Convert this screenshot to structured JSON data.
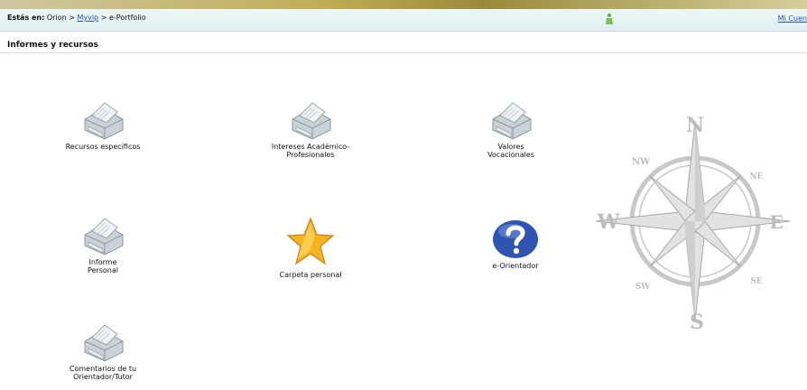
{
  "breadcrumb": {
    "prefix": "Estás en:",
    "root": "Orion",
    "sep1": ">",
    "link": "Myvip",
    "sep2": ">",
    "current": "e-Portfolio"
  },
  "account_link": "Mi Cuen",
  "section": {
    "title": "Informes y recursos"
  },
  "items": [
    {
      "label": "Recursos específicos",
      "icon": "printer-icon"
    },
    {
      "label": "Intereses Académico-Profesionales",
      "icon": "printer-icon"
    },
    {
      "label": "Valores Vocacionales",
      "icon": "printer-icon"
    },
    {
      "label": "Informe Personal",
      "icon": "printer-icon"
    },
    {
      "label": "Carpeta personal",
      "icon": "star-icon"
    },
    {
      "label": "e-Orientador",
      "icon": "question-icon"
    },
    {
      "label": "Comentarios de tu Orientador/Tutor",
      "icon": "printer-icon"
    }
  ],
  "compass": {
    "n": "N",
    "s": "S",
    "e": "E",
    "w": "W",
    "nw": "NW",
    "ne": "NE",
    "sw": "SW",
    "se": "SE"
  },
  "colors": {
    "link": "#2b55a8",
    "header_bar": "#dfeef0",
    "star": "#f4b322",
    "question": "#2f55b0"
  }
}
